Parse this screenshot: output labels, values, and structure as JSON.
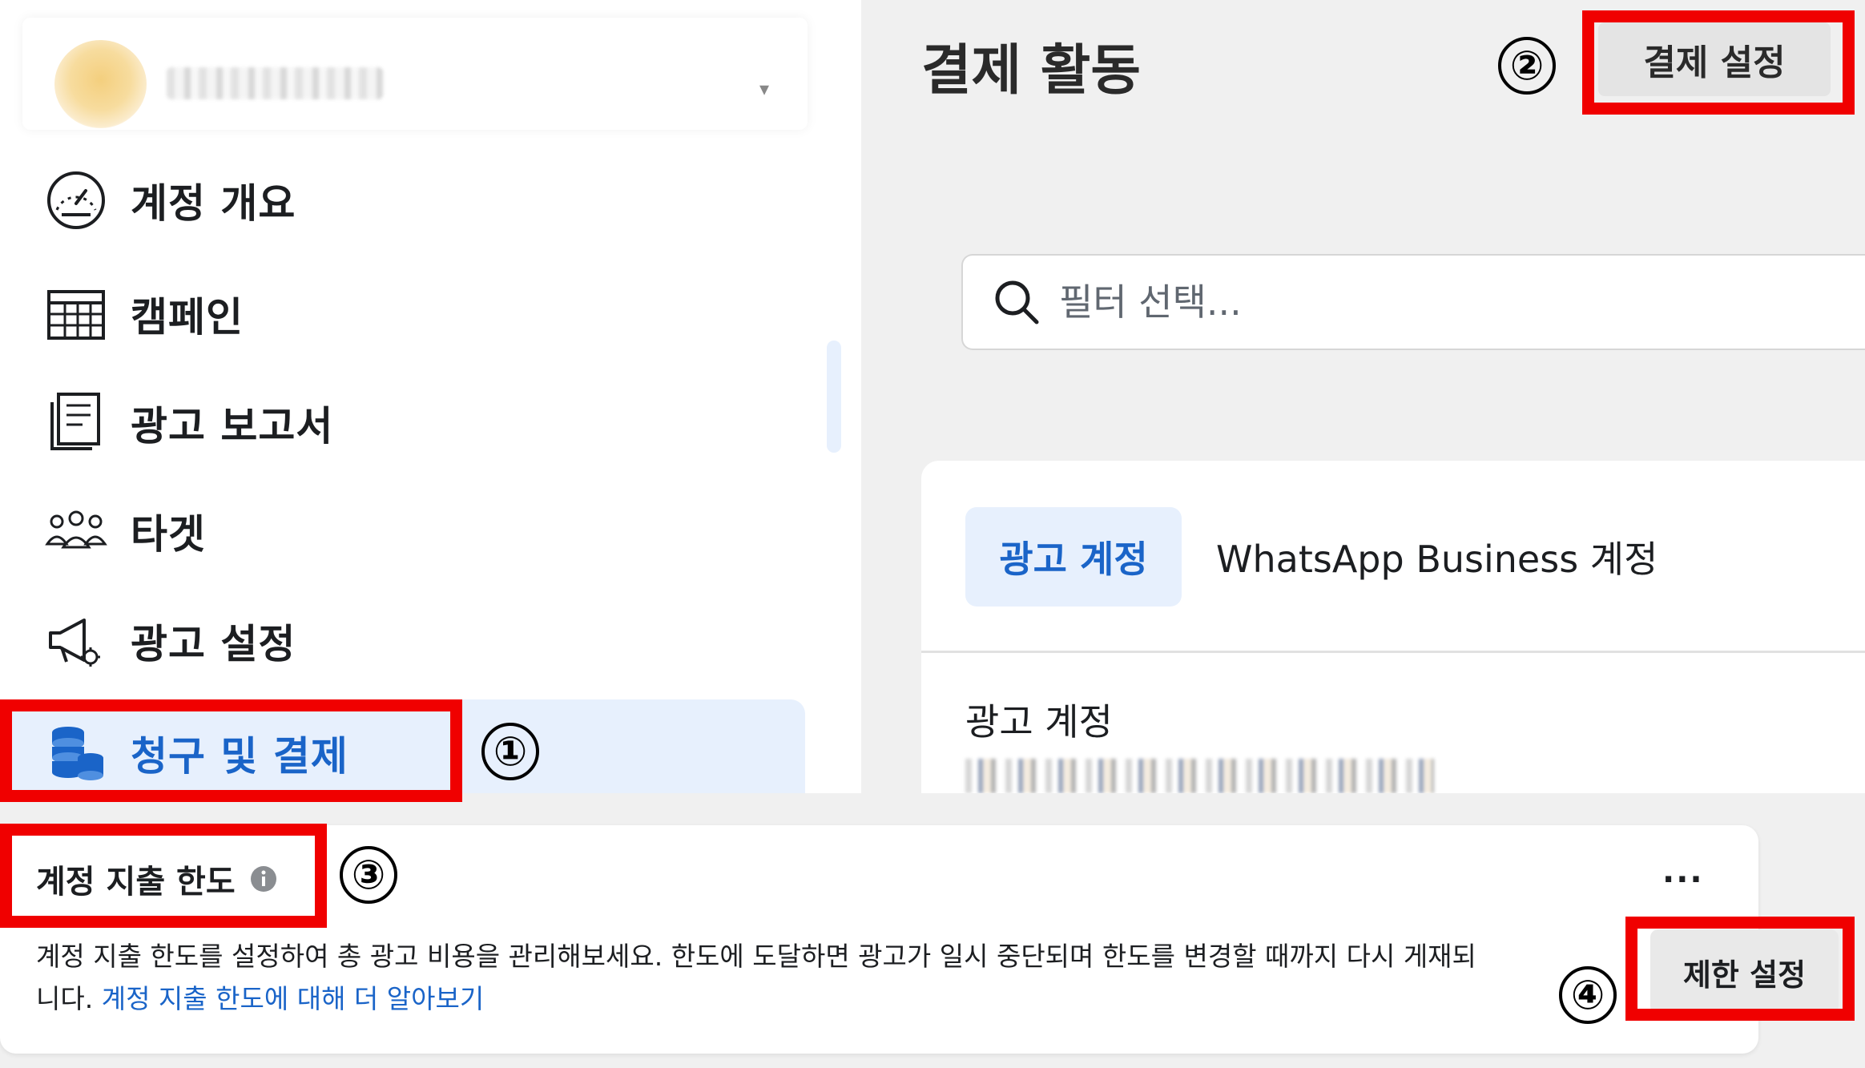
{
  "sidebar": {
    "items": [
      {
        "label": "계정 개요",
        "icon": "dashboard-gauge-icon"
      },
      {
        "label": "캠페인",
        "icon": "table-grid-icon"
      },
      {
        "label": "광고 보고서",
        "icon": "report-document-icon"
      },
      {
        "label": "타겟",
        "icon": "audience-people-icon"
      },
      {
        "label": "광고 설정",
        "icon": "megaphone-settings-icon"
      },
      {
        "label": "청구 및 결제",
        "icon": "billing-coins-icon",
        "active": true
      }
    ]
  },
  "main": {
    "title": "결제 활동",
    "settings_button": "결제 설정",
    "search_placeholder": "필터 선택...",
    "tabs": [
      {
        "label": "광고 계정",
        "active": true
      },
      {
        "label": "WhatsApp Business 계정",
        "active": false
      }
    ],
    "section_label": "광고 계정"
  },
  "limit_card": {
    "title": "계정 지출 한도",
    "more": "···",
    "description": "계정 지출 한도를 설정하여 총 광고 비용을 관리해보세요. 한도에 도달하면 광고가 일시 중단되며 한도를 변경할 때까지 다시 게재되",
    "description_cont": "니다.",
    "link": "계정 지출 한도에 대해 더 알아보기",
    "button": "제한 설정"
  },
  "annotations": {
    "markers": [
      "①",
      "②",
      "③",
      "④"
    ],
    "highlight_color": "#f00000"
  },
  "colors": {
    "accent": "#1a64c8",
    "active_bg": "#e7f0fd",
    "page_bg": "#f0f0f0"
  }
}
